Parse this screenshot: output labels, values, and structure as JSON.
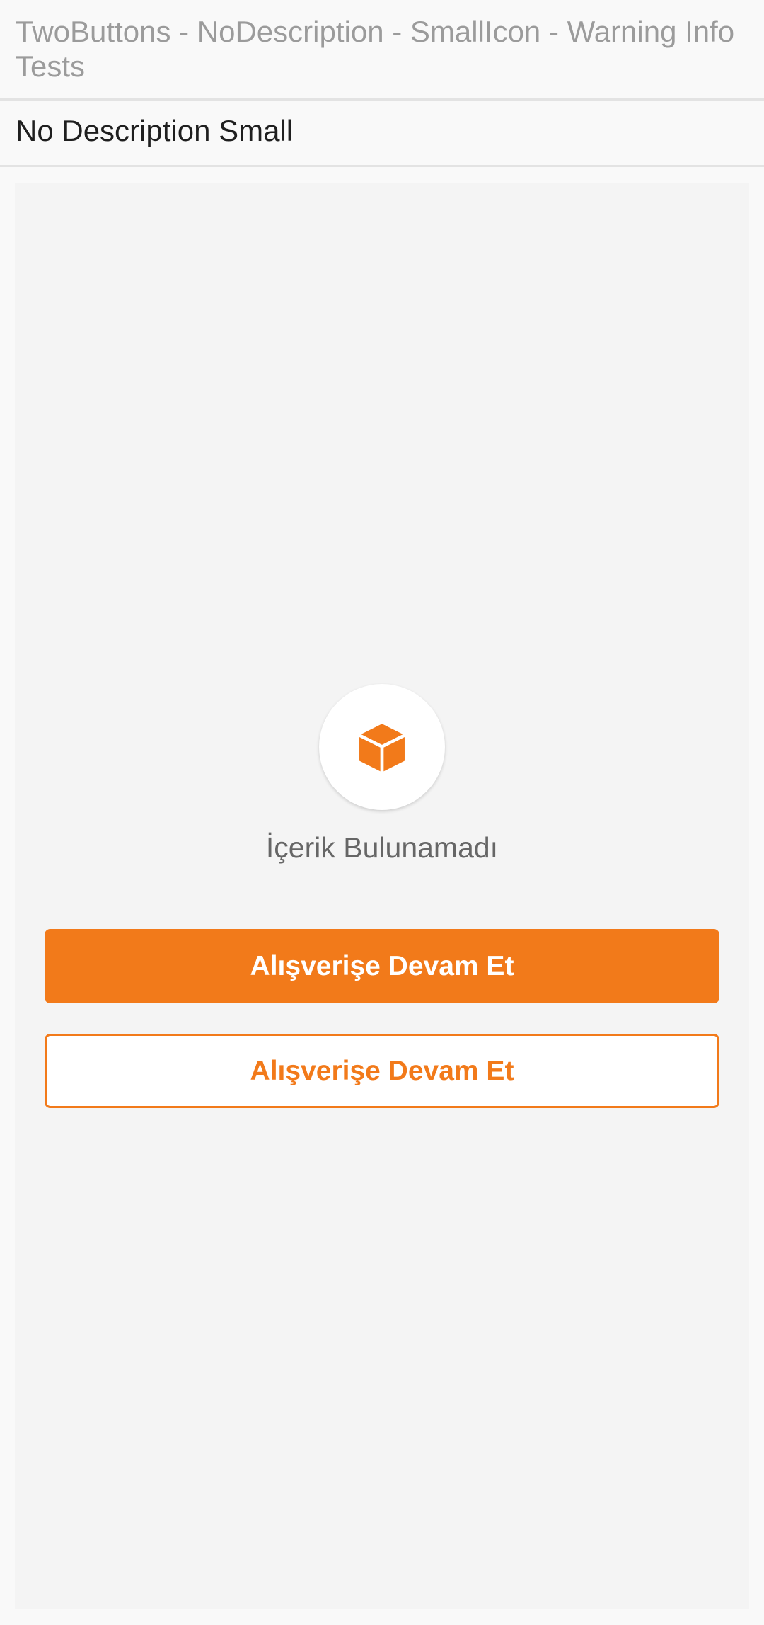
{
  "header": {
    "title": "TwoButtons - NoDescription - SmallIcon - Warning Info Tests"
  },
  "section": {
    "label": "No Description Small"
  },
  "empty_state": {
    "icon": "box-icon",
    "title": "İçerik Bulunamadı",
    "primary_button_label": "Alışverişe Devam Et",
    "secondary_button_label": "Alışverişe Devam Et"
  },
  "colors": {
    "accent": "#f27a1a",
    "background": "#f9f9f9",
    "panel": "#f4f4f4"
  }
}
